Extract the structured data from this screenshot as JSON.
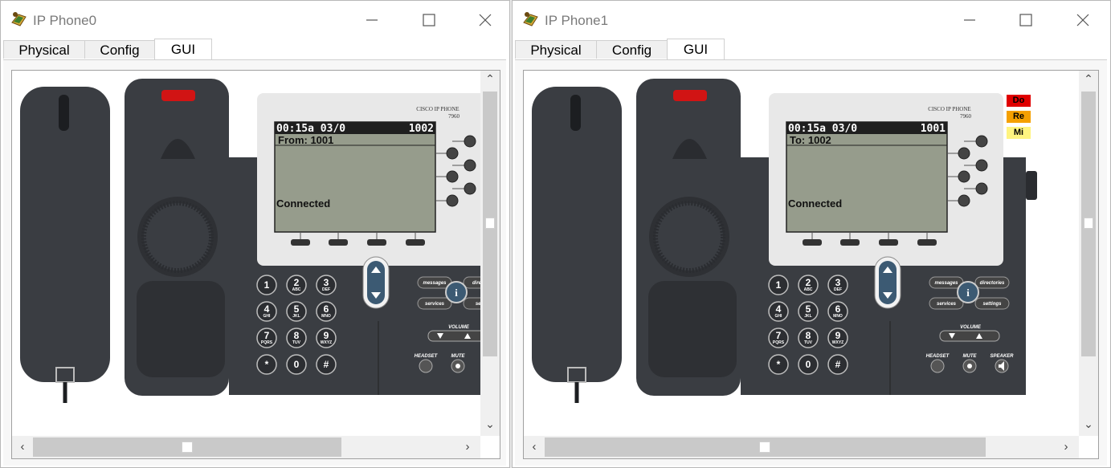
{
  "windows": [
    {
      "title": "IP Phone0",
      "tabs": [
        "Physical",
        "Config",
        "GUI"
      ],
      "active_tab": "GUI",
      "phone": {
        "brand": "CISCO IP PHONE",
        "model": "7960",
        "screen_time": "00:15a 03/0",
        "screen_number": "1002",
        "screen_call_line": "From: 1001",
        "screen_status": "Connected",
        "keys": [
          {
            "num": "1",
            "sub": ""
          },
          {
            "num": "2",
            "sub": "ABC"
          },
          {
            "num": "3",
            "sub": "DEF"
          },
          {
            "num": "4",
            "sub": "GHI"
          },
          {
            "num": "5",
            "sub": "JKL"
          },
          {
            "num": "6",
            "sub": "MNO"
          },
          {
            "num": "7",
            "sub": "PQRS"
          },
          {
            "num": "8",
            "sub": "TUV"
          },
          {
            "num": "9",
            "sub": "WXYZ"
          },
          {
            "num": "*",
            "sub": ""
          },
          {
            "num": "0",
            "sub": ""
          },
          {
            "num": "#",
            "sub": ""
          }
        ],
        "labels": {
          "messages": "messages",
          "directories": "directo",
          "services": "services",
          "settings": "setti",
          "volume": "VOLUME",
          "headset": "HEADSET",
          "mute": "MUTE",
          "speaker": ""
        }
      },
      "side_buttons": []
    },
    {
      "title": "IP Phone1",
      "tabs": [
        "Physical",
        "Config",
        "GUI"
      ],
      "active_tab": "GUI",
      "phone": {
        "brand": "CISCO IP PHONE",
        "model": "7960",
        "screen_time": "00:15a 03/0",
        "screen_number": "1001",
        "screen_call_line": "To: 1002",
        "screen_status": "Connected",
        "keys": [
          {
            "num": "1",
            "sub": ""
          },
          {
            "num": "2",
            "sub": "ABC"
          },
          {
            "num": "3",
            "sub": "DEF"
          },
          {
            "num": "4",
            "sub": "GHI"
          },
          {
            "num": "5",
            "sub": "JKL"
          },
          {
            "num": "6",
            "sub": "MNO"
          },
          {
            "num": "7",
            "sub": "PQRS"
          },
          {
            "num": "8",
            "sub": "TUV"
          },
          {
            "num": "9",
            "sub": "WXYZ"
          },
          {
            "num": "*",
            "sub": ""
          },
          {
            "num": "0",
            "sub": ""
          },
          {
            "num": "#",
            "sub": ""
          }
        ],
        "labels": {
          "messages": "messages",
          "directories": "directories",
          "services": "services",
          "settings": "settings",
          "volume": "VOLUME",
          "headset": "HEADSET",
          "mute": "MUTE",
          "speaker": "SPEAKER"
        }
      },
      "side_buttons": [
        {
          "label": "Do",
          "bg": "#e00000",
          "fg": "#000000"
        },
        {
          "label": "Re",
          "bg": "#f5a000",
          "fg": "#000000"
        },
        {
          "label": "Mi",
          "bg": "#fff480",
          "fg": "#000000"
        }
      ]
    }
  ],
  "colors": {
    "phone_body": "#3a3d42",
    "screen_bg": "#969c8c",
    "screen_header": "#1f1f1f",
    "light_panel": "#e8e8e8",
    "nav_blue": "#3c5a73",
    "indicator_red": "#d11414"
  }
}
